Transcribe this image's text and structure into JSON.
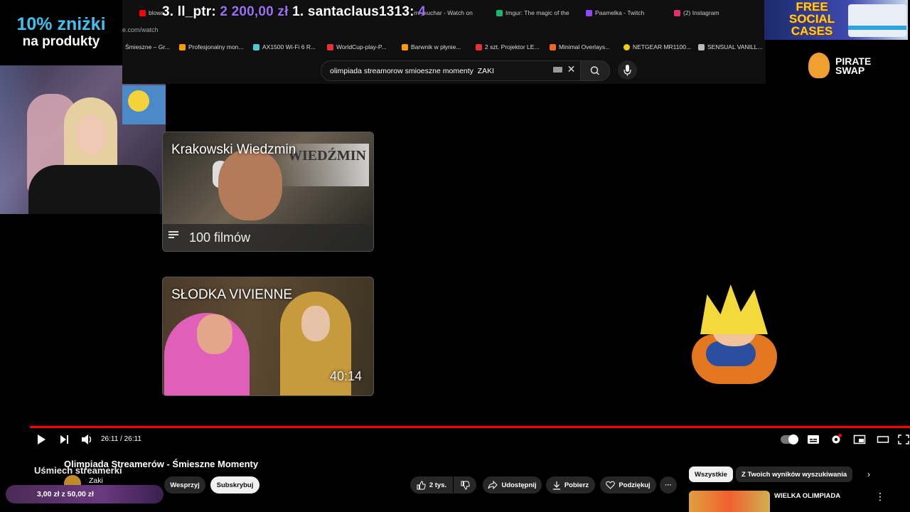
{
  "promo": {
    "line1": "10% zniżki",
    "line2": "na produkty"
  },
  "stream_overlay": {
    "rank3": "3. ll_ptr: ",
    "rank3_amount": "2 200,00 zł",
    "rank1": " 1. santaclaus1313: ",
    "rank1_amount": "4"
  },
  "browser": {
    "tabs": [
      {
        "label": "blows",
        "color": "#ff0000"
      },
      {
        "label": "mrysuchar - Watch on",
        "color": "#6441a5"
      },
      {
        "label": "Imgur: The magic of the",
        "color": "#1bb76e"
      },
      {
        "label": "Paamelka - Twitch",
        "color": "#9146ff"
      },
      {
        "label": "(2) Instagram",
        "color": "#e1306c"
      }
    ],
    "address": "e.com/watch",
    "bookmarks": [
      {
        "label": "Śmieszne – Gr...",
        "color": "#555555"
      },
      {
        "label": "Profesjonalny mon...",
        "color": "#ff9900"
      },
      {
        "label": "AX1500 Wi-Fi 6 R...",
        "color": "#4acbd6"
      },
      {
        "label": "WorldCup-play-P...",
        "color": "#e53238"
      },
      {
        "label": "Barwnik w płynie...",
        "color": "#ff9900"
      },
      {
        "label": "2 szt. Projektor LE...",
        "color": "#e53238"
      },
      {
        "label": "Minimal Overlays...",
        "color": "#f26522"
      },
      {
        "label": "NETGEAR MR1100...",
        "color": "#f0d000"
      },
      {
        "label": "SENSUAL VANILL...",
        "color": "#bbbbbb"
      }
    ],
    "search_value": "olimpiada streamorow smioeszne momenty  ZAKI"
  },
  "ads": {
    "social_cases": "FREE SOCIAL CASES",
    "pirate_swap": "PIRATE SWAP"
  },
  "results": [
    {
      "title": "Krakowski Wiedzmin",
      "meta": "100 filmów",
      "logo": "WIEDŹMIN"
    },
    {
      "title": "SŁODKA VIVIENNE",
      "meta": "40:14"
    }
  ],
  "player": {
    "time": "26:11 / 26:11",
    "progress": 1.0,
    "accent": "#ff0000"
  },
  "video": {
    "title": "Olimpiada Streamerów - Śmieszne Momenty",
    "overlay_title": "Uśmiech streamerki",
    "channel": "Zaki",
    "donation": "3,00 zł z 50,00 zł",
    "join": "Wesprzyj",
    "subscribe": "Subskrybuj",
    "likes": "2 tys.",
    "share": "Udostępnij",
    "download": "Pobierz",
    "thanks": "Podziękuj",
    "more": "···"
  },
  "sidebar": {
    "chips": [
      "Wszystkie",
      "Z Twoich wyników wyszukiwania"
    ],
    "rec_title": "WIELKA OLIMPIADA"
  }
}
